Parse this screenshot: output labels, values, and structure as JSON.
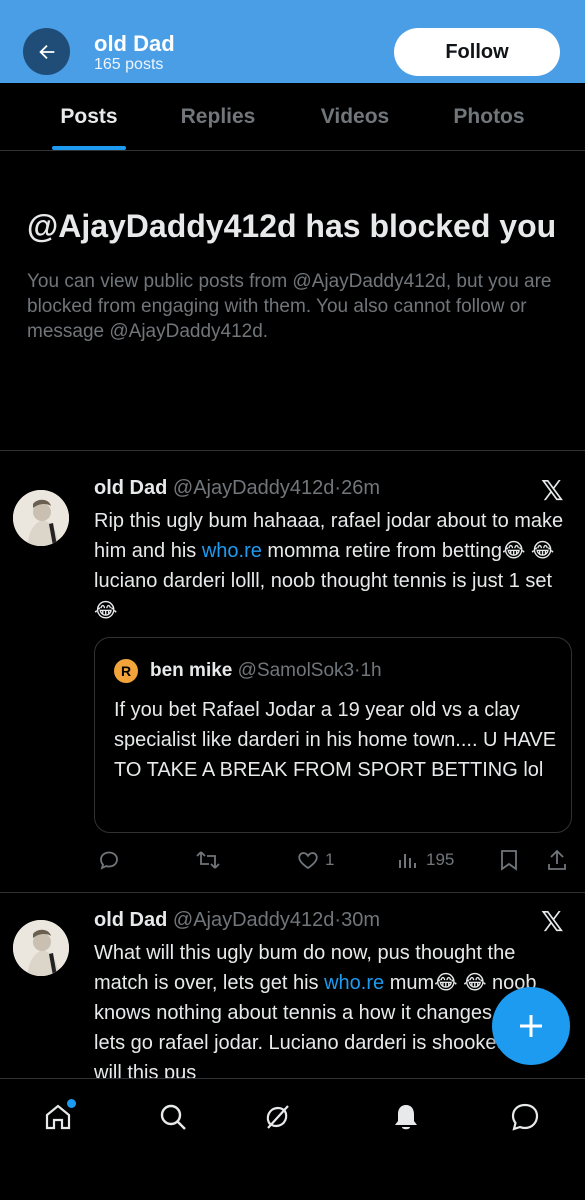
{
  "header": {
    "name": "old Dad",
    "post_count": "165 posts",
    "follow_label": "Follow",
    "background_color": "#4a9ee6"
  },
  "tabs": [
    {
      "label": "Posts",
      "active": true
    },
    {
      "label": "Replies",
      "active": false
    },
    {
      "label": "Videos",
      "active": false
    },
    {
      "label": "Photos",
      "active": false
    }
  ],
  "blocked": {
    "title": "@AjayDaddy412d has blocked you",
    "description": "You can view public posts from @AjayDaddy412d, but you are blocked from engaging with them. You also cannot follow or message @AjayDaddy412d."
  },
  "posts": [
    {
      "name": "old Dad",
      "handle": "@AjayDaddy412d",
      "time": "26m",
      "text_before": "Rip this ugly bum hahaaa, rafael jodar about to make him and his ",
      "link": "who.re",
      "text_after": " momma retire from betting😂 😂 luciano darderi lolll, noob thought tennis is just 1 set 😂",
      "quote": {
        "name": "ben mike",
        "handle": "@SamolSok3",
        "time": "1h",
        "text": "If you bet Rafael Jodar a 19 year old vs a clay specialist like darderi in his home town.... U HAVE TO TAKE A BREAK FROM SPORT BETTING lol"
      },
      "actions": {
        "replies": "",
        "reposts": "",
        "likes": "1",
        "views": "195"
      }
    },
    {
      "name": "old Dad",
      "handle": "@AjayDaddy412d",
      "time": "30m",
      "text_before": "What will this ugly bum do now, pus thought the match is over, lets get his ",
      "link": "who.re",
      "text_after": " mum😂 😂 noob knows nothing about tennis a how it changes lolll, lets go rafael jodar. Luciano darderi is shooked😂 will this pus"
    }
  ],
  "icons": {
    "back": "arrow-left-icon",
    "x_logo": "x-logo-icon",
    "fab": "plus-icon",
    "nav": [
      "home-icon",
      "search-icon",
      "grok-icon",
      "notifications-icon",
      "messages-icon"
    ]
  },
  "colors": {
    "accent": "#1d9bf0",
    "muted": "#71767b",
    "text": "#e7e9ea"
  }
}
